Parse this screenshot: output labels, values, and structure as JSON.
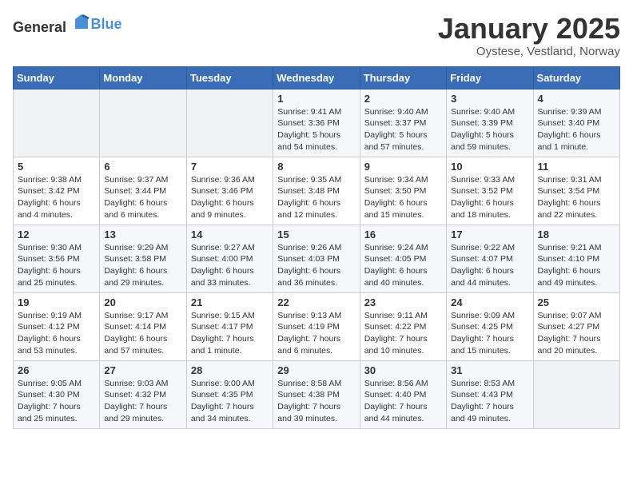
{
  "logo": {
    "general": "General",
    "blue": "Blue"
  },
  "header": {
    "month": "January 2025",
    "location": "Oystese, Vestland, Norway"
  },
  "weekdays": [
    "Sunday",
    "Monday",
    "Tuesday",
    "Wednesday",
    "Thursday",
    "Friday",
    "Saturday"
  ],
  "weeks": [
    [
      {
        "day": "",
        "info": ""
      },
      {
        "day": "",
        "info": ""
      },
      {
        "day": "",
        "info": ""
      },
      {
        "day": "1",
        "info": "Sunrise: 9:41 AM\nSunset: 3:36 PM\nDaylight: 5 hours\nand 54 minutes."
      },
      {
        "day": "2",
        "info": "Sunrise: 9:40 AM\nSunset: 3:37 PM\nDaylight: 5 hours\nand 57 minutes."
      },
      {
        "day": "3",
        "info": "Sunrise: 9:40 AM\nSunset: 3:39 PM\nDaylight: 5 hours\nand 59 minutes."
      },
      {
        "day": "4",
        "info": "Sunrise: 9:39 AM\nSunset: 3:40 PM\nDaylight: 6 hours\nand 1 minute."
      }
    ],
    [
      {
        "day": "5",
        "info": "Sunrise: 9:38 AM\nSunset: 3:42 PM\nDaylight: 6 hours\nand 4 minutes."
      },
      {
        "day": "6",
        "info": "Sunrise: 9:37 AM\nSunset: 3:44 PM\nDaylight: 6 hours\nand 6 minutes."
      },
      {
        "day": "7",
        "info": "Sunrise: 9:36 AM\nSunset: 3:46 PM\nDaylight: 6 hours\nand 9 minutes."
      },
      {
        "day": "8",
        "info": "Sunrise: 9:35 AM\nSunset: 3:48 PM\nDaylight: 6 hours\nand 12 minutes."
      },
      {
        "day": "9",
        "info": "Sunrise: 9:34 AM\nSunset: 3:50 PM\nDaylight: 6 hours\nand 15 minutes."
      },
      {
        "day": "10",
        "info": "Sunrise: 9:33 AM\nSunset: 3:52 PM\nDaylight: 6 hours\nand 18 minutes."
      },
      {
        "day": "11",
        "info": "Sunrise: 9:31 AM\nSunset: 3:54 PM\nDaylight: 6 hours\nand 22 minutes."
      }
    ],
    [
      {
        "day": "12",
        "info": "Sunrise: 9:30 AM\nSunset: 3:56 PM\nDaylight: 6 hours\nand 25 minutes."
      },
      {
        "day": "13",
        "info": "Sunrise: 9:29 AM\nSunset: 3:58 PM\nDaylight: 6 hours\nand 29 minutes."
      },
      {
        "day": "14",
        "info": "Sunrise: 9:27 AM\nSunset: 4:00 PM\nDaylight: 6 hours\nand 33 minutes."
      },
      {
        "day": "15",
        "info": "Sunrise: 9:26 AM\nSunset: 4:03 PM\nDaylight: 6 hours\nand 36 minutes."
      },
      {
        "day": "16",
        "info": "Sunrise: 9:24 AM\nSunset: 4:05 PM\nDaylight: 6 hours\nand 40 minutes."
      },
      {
        "day": "17",
        "info": "Sunrise: 9:22 AM\nSunset: 4:07 PM\nDaylight: 6 hours\nand 44 minutes."
      },
      {
        "day": "18",
        "info": "Sunrise: 9:21 AM\nSunset: 4:10 PM\nDaylight: 6 hours\nand 49 minutes."
      }
    ],
    [
      {
        "day": "19",
        "info": "Sunrise: 9:19 AM\nSunset: 4:12 PM\nDaylight: 6 hours\nand 53 minutes."
      },
      {
        "day": "20",
        "info": "Sunrise: 9:17 AM\nSunset: 4:14 PM\nDaylight: 6 hours\nand 57 minutes."
      },
      {
        "day": "21",
        "info": "Sunrise: 9:15 AM\nSunset: 4:17 PM\nDaylight: 7 hours\nand 1 minute."
      },
      {
        "day": "22",
        "info": "Sunrise: 9:13 AM\nSunset: 4:19 PM\nDaylight: 7 hours\nand 6 minutes."
      },
      {
        "day": "23",
        "info": "Sunrise: 9:11 AM\nSunset: 4:22 PM\nDaylight: 7 hours\nand 10 minutes."
      },
      {
        "day": "24",
        "info": "Sunrise: 9:09 AM\nSunset: 4:25 PM\nDaylight: 7 hours\nand 15 minutes."
      },
      {
        "day": "25",
        "info": "Sunrise: 9:07 AM\nSunset: 4:27 PM\nDaylight: 7 hours\nand 20 minutes."
      }
    ],
    [
      {
        "day": "26",
        "info": "Sunrise: 9:05 AM\nSunset: 4:30 PM\nDaylight: 7 hours\nand 25 minutes."
      },
      {
        "day": "27",
        "info": "Sunrise: 9:03 AM\nSunset: 4:32 PM\nDaylight: 7 hours\nand 29 minutes."
      },
      {
        "day": "28",
        "info": "Sunrise: 9:00 AM\nSunset: 4:35 PM\nDaylight: 7 hours\nand 34 minutes."
      },
      {
        "day": "29",
        "info": "Sunrise: 8:58 AM\nSunset: 4:38 PM\nDaylight: 7 hours\nand 39 minutes."
      },
      {
        "day": "30",
        "info": "Sunrise: 8:56 AM\nSunset: 4:40 PM\nDaylight: 7 hours\nand 44 minutes."
      },
      {
        "day": "31",
        "info": "Sunrise: 8:53 AM\nSunset: 4:43 PM\nDaylight: 7 hours\nand 49 minutes."
      },
      {
        "day": "",
        "info": ""
      }
    ]
  ]
}
